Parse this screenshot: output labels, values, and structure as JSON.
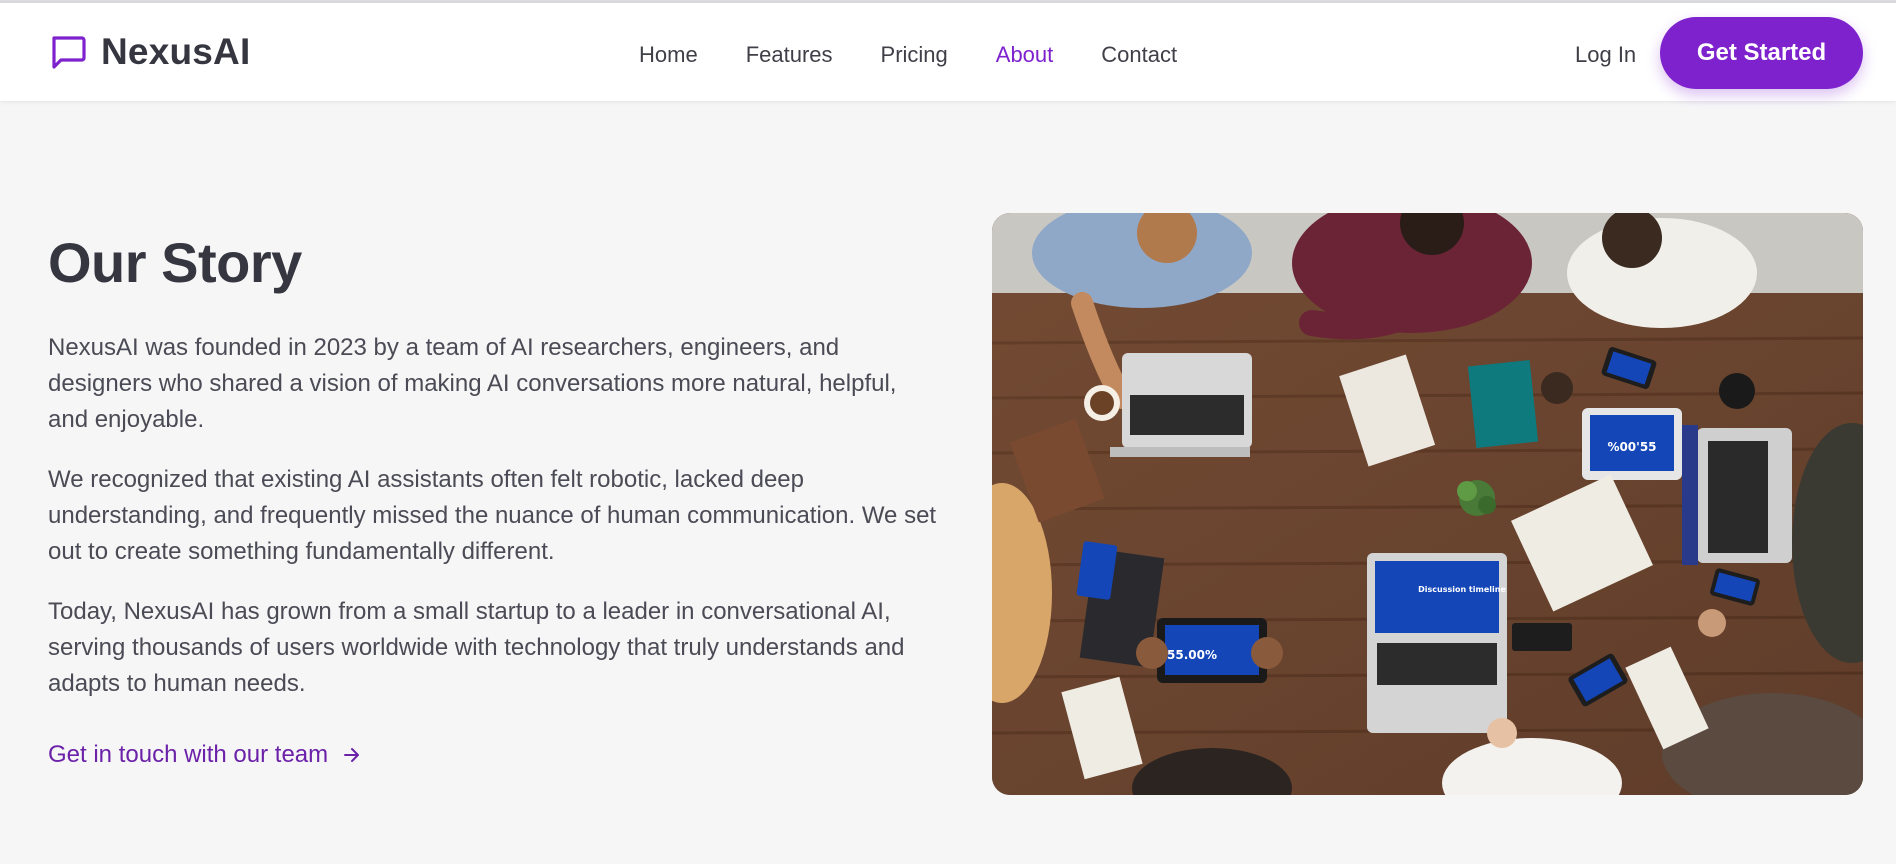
{
  "brand": {
    "name": "NexusAI",
    "icon": "chat-bubble-icon",
    "accent": "#7e22ce"
  },
  "nav": {
    "items": [
      {
        "label": "Home",
        "active": false
      },
      {
        "label": "Features",
        "active": false
      },
      {
        "label": "Pricing",
        "active": false
      },
      {
        "label": "About",
        "active": true
      },
      {
        "label": "Contact",
        "active": false
      }
    ],
    "login_label": "Log In",
    "cta_label": "Get Started"
  },
  "story": {
    "title": "Our Story",
    "paragraphs": [
      "NexusAI was founded in 2023 by a team of AI researchers, engineers, and designers who shared a vision of making AI conversations more natural, helpful, and enjoyable.",
      "We recognized that existing AI assistants often felt robotic, lacked deep understanding, and frequently missed the nuance of human communication. We set out to create something fundamentally different.",
      "Today, NexusAI has grown from a small startup to a leader in conversational AI, serving thousands of users worldwide with technology that truly understands and adapts to human needs."
    ],
    "link_label": "Get in touch with our team",
    "link_icon": "arrow-right-icon"
  },
  "image": {
    "alt": "team-meeting-photo",
    "tablet_text_1": "55.00%",
    "tablet_text_2": "%00'55",
    "laptop_text": "Discussion timeline"
  }
}
